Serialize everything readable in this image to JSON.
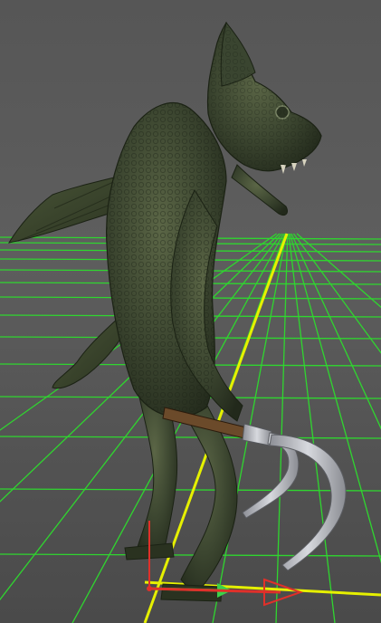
{
  "viewport": {
    "background": "#5c5c5c",
    "grid_color": "#2fd62f",
    "axis_x_color": "#e6f000",
    "gizmo": {
      "x_axis_color": "#e0302a",
      "y_axis_color": "#e0302a",
      "z_axis_color": "#3ad24a"
    },
    "model": {
      "type": "gargoyle-creature",
      "skin_color": "#3f4a2e",
      "weapon": "hook-pitchfork"
    }
  }
}
